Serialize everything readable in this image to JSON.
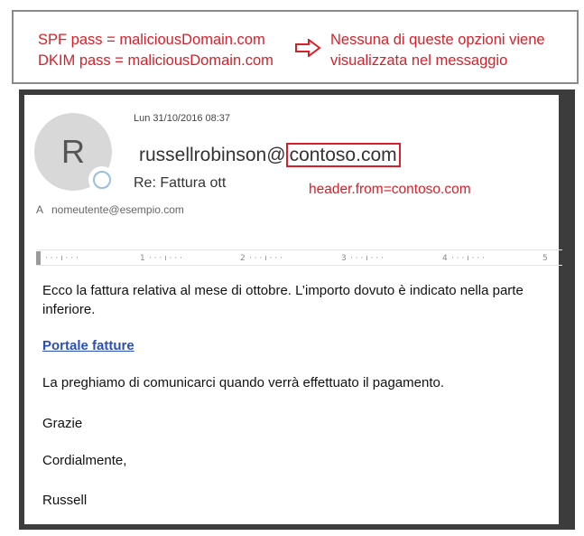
{
  "annotation": {
    "spf_line": "SPF pass = maliciousDomain.com",
    "dkim_line": "DKIM pass = maliciousDomain.com",
    "result_line1": "Nessuna di queste opzioni viene",
    "result_line2": "visualizzata nel messaggio",
    "header_from_note": "header.from=contoso.com",
    "accent_color": "#d9202a"
  },
  "email": {
    "avatar_initial": "R",
    "date": "Lun 31/10/2016 08:37",
    "sender_user": "russellrobinson@",
    "sender_domain": "contoso.com",
    "subject": "Re: Fattura ott",
    "to_label": "A",
    "to_address": "nomeutente@esempio.com",
    "ruler_marks": [
      "1",
      "2",
      "3",
      "4",
      "5"
    ],
    "body": {
      "paragraph1": "Ecco la fattura relativa al mese di ottobre. L’importo dovuto è indicato nella parte inferiore.",
      "link_text": "Portale fatture",
      "paragraph2": "La preghiamo di comunicarci quando verrà effettuato il pagamento.",
      "paragraph3": "Grazie",
      "closing": "Cordialmente,",
      "signature": "Russell"
    }
  }
}
